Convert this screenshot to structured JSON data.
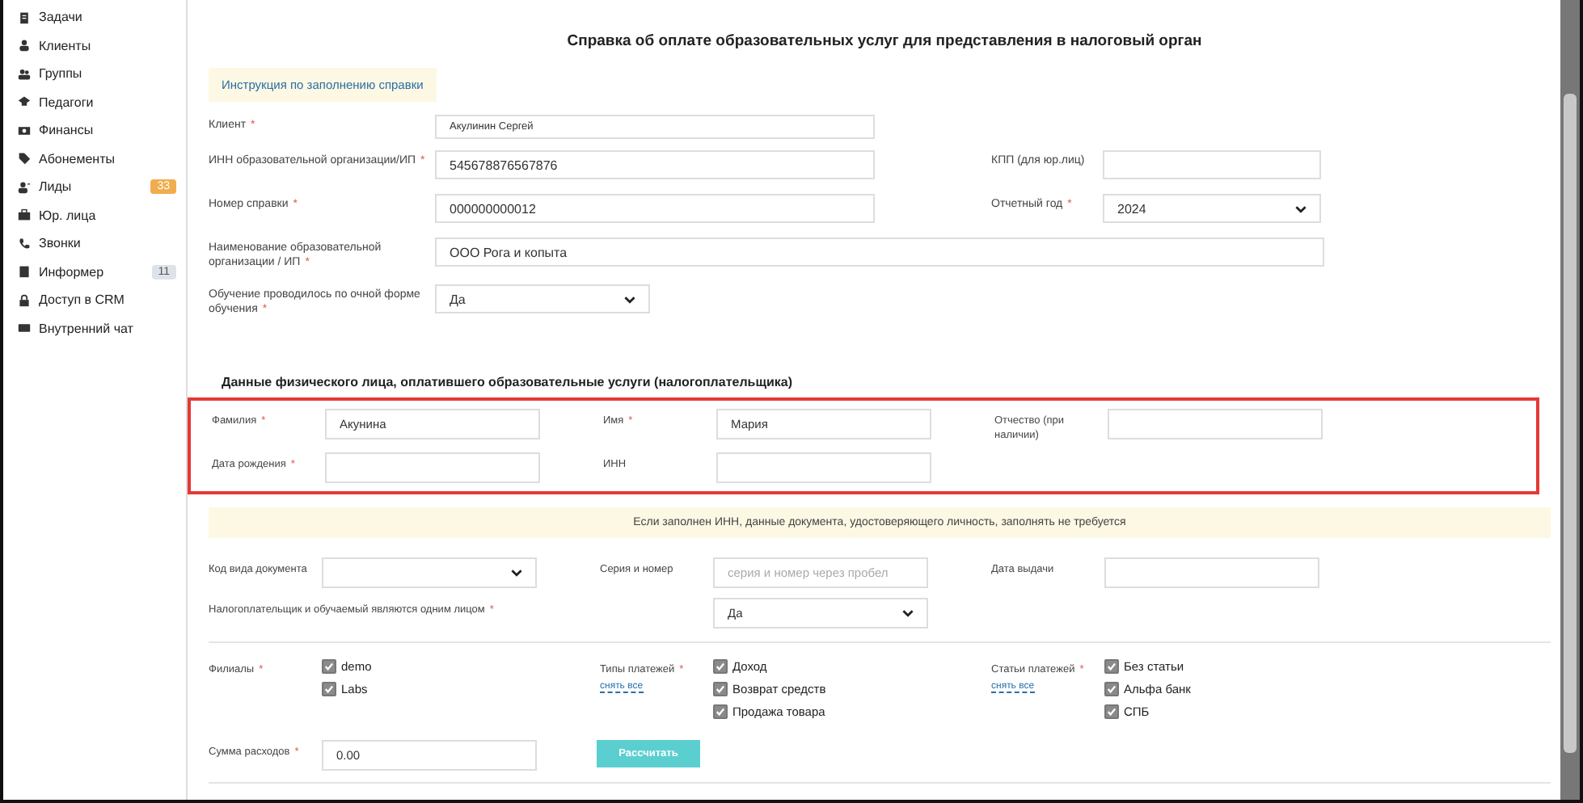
{
  "sidebar": {
    "items": [
      {
        "label": "Задачи"
      },
      {
        "label": "Клиенты"
      },
      {
        "label": "Группы"
      },
      {
        "label": "Педагоги"
      },
      {
        "label": "Финансы"
      },
      {
        "label": "Абонементы"
      },
      {
        "label": "Лиды",
        "badge": "33",
        "color": "#f0ad4e"
      },
      {
        "label": "Юр. лица"
      },
      {
        "label": "Звонки"
      },
      {
        "label": "Информер",
        "badge": "11",
        "color": "#dde3e8"
      },
      {
        "label": "Доступ в CRM"
      },
      {
        "label": "Внутренний чат"
      }
    ]
  },
  "form": {
    "title": "Справка об оплате образовательных услуг для представления в налоговый орган",
    "instruction_link": "Инструкция по заполнению справки",
    "org_rows": [
      {
        "fields": [
          {
            "label": "Клиент",
            "required": true,
            "kind": "input",
            "value": "Акулинин Сергей"
          }
        ]
      },
      {
        "fields": [
          {
            "label": "ИНН образовательной организации/ИП",
            "required": true,
            "kind": "input",
            "value": "545678876567876"
          },
          {
            "label": "КПП (для юр.лиц)",
            "required": false,
            "kind": "input"
          }
        ]
      },
      {
        "fields": [
          {
            "label": "Номер справки",
            "required": true,
            "kind": "input",
            "value": "000000000012"
          },
          {
            "label": "Отчетный год",
            "required": true,
            "kind": "select",
            "value": "2024"
          }
        ]
      },
      {
        "fields": [
          {
            "label": "Наименование образовательной организации / ИП",
            "required": true,
            "kind": "input",
            "value": "ООО Рога и копыта"
          }
        ]
      },
      {
        "fields": [
          {
            "label": "Обучение проводилось по очной форме обучения",
            "required": true,
            "kind": "select",
            "value": "Да"
          }
        ]
      }
    ],
    "person_title": "Данные физического лица, оплатившего образовательные услуги (налогоплательщика)",
    "person_rows": [
      {
        "fields": [
          {
            "label": "Фамилия",
            "required": true,
            "kind": "input",
            "value": "Акунина"
          },
          {
            "label": "Имя",
            "required": true,
            "kind": "input",
            "value": "Мария"
          },
          {
            "label": "Отчество (при наличии)",
            "required": false,
            "kind": "input"
          }
        ]
      },
      {
        "fields": [
          {
            "label": "Дата рождения",
            "required": true,
            "kind": "input"
          },
          {
            "label": "ИНН",
            "required": false,
            "kind": "input"
          }
        ]
      }
    ],
    "notice": "Если заполнен ИНН, данные документа, удостоверяющего личность, заполнять не требуется",
    "doc_rows": [
      {
        "fields": [
          {
            "label": "Код вида документа",
            "required": false,
            "kind": "select"
          },
          {
            "label": "Серия и номер",
            "required": false,
            "kind": "input",
            "placeholder": "серия и номер через пробел"
          },
          {
            "label": "Дата выдачи",
            "required": false,
            "kind": "input"
          }
        ]
      },
      {
        "fields": [
          {
            "label": "Налогоплательщик и обучаемый являются одним лицом",
            "required": true,
            "kind": "wide_select",
            "value": "Да"
          }
        ]
      }
    ],
    "check_groups": [
      {
        "label": "Филиалы",
        "required": true,
        "items": [
          {
            "label": "demo",
            "checked": true
          },
          {
            "label": "Labs",
            "checked": true
          }
        ]
      },
      {
        "label": "Типы платежей",
        "required": true,
        "link": "снять все",
        "items": [
          {
            "label": "Доход",
            "checked": true
          },
          {
            "label": "Возврат средств",
            "checked": true
          },
          {
            "label": "Продажа товара",
            "checked": true
          }
        ]
      },
      {
        "label": "Статьи платежей",
        "required": true,
        "link": "снять все",
        "items": [
          {
            "label": "Без статьи",
            "checked": true
          },
          {
            "label": "Альфа банк",
            "checked": true
          },
          {
            "label": "СПБ",
            "checked": true
          }
        ]
      }
    ],
    "sum": {
      "label": "Сумма расходов",
      "required": true,
      "value": "0.00"
    },
    "calc_button": "Рассчитать",
    "required_mark": "*"
  }
}
